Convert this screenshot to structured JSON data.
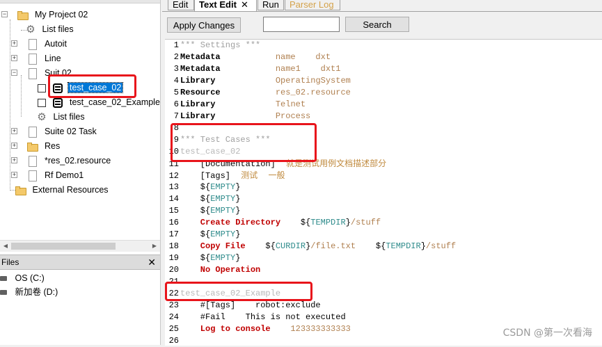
{
  "tree": {
    "project": "My Project 02",
    "items": [
      {
        "label": "List files"
      },
      {
        "label": "Autoit"
      },
      {
        "label": "Line"
      },
      {
        "label": "Suit 02"
      },
      {
        "label": "test_case_02"
      },
      {
        "label": "test_case_02_Example"
      },
      {
        "label": "List files"
      },
      {
        "label": "Suite 02 Task"
      },
      {
        "label": "Res"
      },
      {
        "label": "*res_02.resource"
      },
      {
        "label": "Rf Demo1"
      },
      {
        "label": "External Resources"
      }
    ]
  },
  "files_panel": {
    "title": "Files",
    "close": "✕",
    "drives": [
      {
        "label": "OS (C:)"
      },
      {
        "label": "新加卷 (D:)"
      }
    ]
  },
  "tabs": [
    {
      "label": "Edit"
    },
    {
      "label": "Text Edit",
      "close": "✕"
    },
    {
      "label": "Run"
    },
    {
      "label": "Parser Log"
    }
  ],
  "toolbar": {
    "apply_label": "Apply Changes",
    "search_value": "",
    "search_label": "Search"
  },
  "editor": {
    "lines": [
      {
        "n": "1",
        "parts": [
          {
            "t": "*** Settings ***",
            "c": "c-hdr"
          }
        ]
      },
      {
        "n": "2",
        "parts": [
          {
            "t": "Metadata",
            "c": "c-kw"
          },
          {
            "t": "           name    dxt",
            "c": "c-val"
          }
        ]
      },
      {
        "n": "3",
        "parts": [
          {
            "t": "Metadata",
            "c": "c-kw"
          },
          {
            "t": "           name1    dxt1",
            "c": "c-val"
          }
        ]
      },
      {
        "n": "4",
        "parts": [
          {
            "t": "Library",
            "c": "c-kw"
          },
          {
            "t": "            OperatingSystem",
            "c": "c-val"
          }
        ]
      },
      {
        "n": "5",
        "parts": [
          {
            "t": "Resource",
            "c": "c-kw"
          },
          {
            "t": "           res_02.resource",
            "c": "c-val"
          }
        ]
      },
      {
        "n": "6",
        "parts": [
          {
            "t": "Library",
            "c": "c-kw"
          },
          {
            "t": "            Telnet",
            "c": "c-val"
          }
        ]
      },
      {
        "n": "7",
        "parts": [
          {
            "t": "Library",
            "c": "c-kw"
          },
          {
            "t": "            Process",
            "c": "c-val"
          }
        ]
      },
      {
        "n": "8",
        "parts": []
      },
      {
        "n": "9",
        "parts": [
          {
            "t": "*** Test Cases ***",
            "c": "c-hdr"
          }
        ]
      },
      {
        "n": "10",
        "parts": [
          {
            "t": "test_case_02",
            "c": "c-tc"
          }
        ]
      },
      {
        "n": "11",
        "parts": [
          {
            "t": "    [Documentation]",
            "c": "c-set"
          },
          {
            "t": "    就是测试用例文档描述部分",
            "c": "c-cjk"
          }
        ]
      },
      {
        "n": "12",
        "parts": [
          {
            "t": "    [Tags]",
            "c": "c-set"
          },
          {
            "t": "    测试    一般",
            "c": "c-cjk"
          }
        ]
      },
      {
        "n": "13",
        "parts": [
          {
            "t": "    ${",
            "c": "c-dollar"
          },
          {
            "t": "EMPTY",
            "c": "c-var"
          },
          {
            "t": "}",
            "c": "c-dollar"
          }
        ]
      },
      {
        "n": "14",
        "parts": [
          {
            "t": "    ${",
            "c": "c-dollar"
          },
          {
            "t": "EMPTY",
            "c": "c-var"
          },
          {
            "t": "}",
            "c": "c-dollar"
          }
        ]
      },
      {
        "n": "15",
        "parts": [
          {
            "t": "    ${",
            "c": "c-dollar"
          },
          {
            "t": "EMPTY",
            "c": "c-var"
          },
          {
            "t": "}",
            "c": "c-dollar"
          }
        ]
      },
      {
        "n": "16",
        "parts": [
          {
            "t": "    Create Directory",
            "c": "c-red"
          },
          {
            "t": "    ${",
            "c": "c-dollar"
          },
          {
            "t": "TEMPDIR",
            "c": "c-var"
          },
          {
            "t": "}",
            "c": "c-dollar"
          },
          {
            "t": "/stuff",
            "c": "c-val"
          }
        ]
      },
      {
        "n": "17",
        "parts": [
          {
            "t": "    ${",
            "c": "c-dollar"
          },
          {
            "t": "EMPTY",
            "c": "c-var"
          },
          {
            "t": "}",
            "c": "c-dollar"
          }
        ]
      },
      {
        "n": "18",
        "parts": [
          {
            "t": "    Copy File",
            "c": "c-red"
          },
          {
            "t": "    ${",
            "c": "c-dollar"
          },
          {
            "t": "CURDIR",
            "c": "c-var"
          },
          {
            "t": "}",
            "c": "c-dollar"
          },
          {
            "t": "/file.txt",
            "c": "c-val"
          },
          {
            "t": "    ${",
            "c": "c-dollar"
          },
          {
            "t": "TEMPDIR",
            "c": "c-var"
          },
          {
            "t": "}",
            "c": "c-dollar"
          },
          {
            "t": "/stuff",
            "c": "c-val"
          }
        ]
      },
      {
        "n": "19",
        "parts": [
          {
            "t": "    ${",
            "c": "c-dollar"
          },
          {
            "t": "EMPTY",
            "c": "c-var"
          },
          {
            "t": "}",
            "c": "c-dollar"
          }
        ]
      },
      {
        "n": "20",
        "parts": [
          {
            "t": "    No Operation",
            "c": "c-red"
          }
        ]
      },
      {
        "n": "21",
        "parts": []
      },
      {
        "n": "22",
        "parts": [
          {
            "t": "test_case_02_Example",
            "c": "c-tc"
          }
        ]
      },
      {
        "n": "23",
        "parts": [
          {
            "t": "    #[Tags]    robot:exclude",
            "c": "c-comment"
          }
        ]
      },
      {
        "n": "24",
        "parts": [
          {
            "t": "    #Fail    This is not executed",
            "c": "c-comment"
          }
        ]
      },
      {
        "n": "25",
        "parts": [
          {
            "t": "    Log to console",
            "c": "c-red"
          },
          {
            "t": "    123333333333",
            "c": "c-num"
          }
        ]
      },
      {
        "n": "26",
        "parts": []
      }
    ]
  },
  "watermark": "CSDN @第一次看海"
}
